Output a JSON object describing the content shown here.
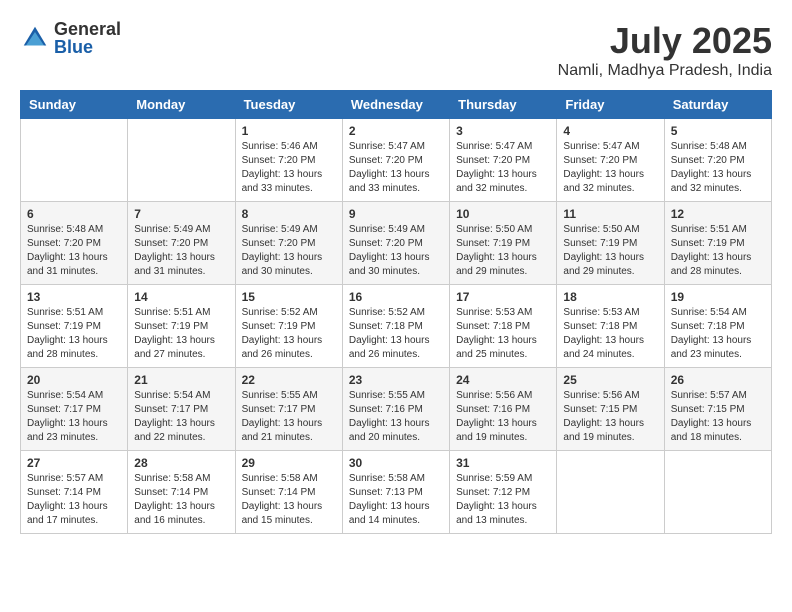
{
  "logo": {
    "general": "General",
    "blue": "Blue"
  },
  "title": {
    "month_year": "July 2025",
    "location": "Namli, Madhya Pradesh, India"
  },
  "headers": [
    "Sunday",
    "Monday",
    "Tuesday",
    "Wednesday",
    "Thursday",
    "Friday",
    "Saturday"
  ],
  "weeks": [
    [
      {
        "day": "",
        "info": ""
      },
      {
        "day": "",
        "info": ""
      },
      {
        "day": "1",
        "info": "Sunrise: 5:46 AM\nSunset: 7:20 PM\nDaylight: 13 hours\nand 33 minutes."
      },
      {
        "day": "2",
        "info": "Sunrise: 5:47 AM\nSunset: 7:20 PM\nDaylight: 13 hours\nand 33 minutes."
      },
      {
        "day": "3",
        "info": "Sunrise: 5:47 AM\nSunset: 7:20 PM\nDaylight: 13 hours\nand 32 minutes."
      },
      {
        "day": "4",
        "info": "Sunrise: 5:47 AM\nSunset: 7:20 PM\nDaylight: 13 hours\nand 32 minutes."
      },
      {
        "day": "5",
        "info": "Sunrise: 5:48 AM\nSunset: 7:20 PM\nDaylight: 13 hours\nand 32 minutes."
      }
    ],
    [
      {
        "day": "6",
        "info": "Sunrise: 5:48 AM\nSunset: 7:20 PM\nDaylight: 13 hours\nand 31 minutes."
      },
      {
        "day": "7",
        "info": "Sunrise: 5:49 AM\nSunset: 7:20 PM\nDaylight: 13 hours\nand 31 minutes."
      },
      {
        "day": "8",
        "info": "Sunrise: 5:49 AM\nSunset: 7:20 PM\nDaylight: 13 hours\nand 30 minutes."
      },
      {
        "day": "9",
        "info": "Sunrise: 5:49 AM\nSunset: 7:20 PM\nDaylight: 13 hours\nand 30 minutes."
      },
      {
        "day": "10",
        "info": "Sunrise: 5:50 AM\nSunset: 7:19 PM\nDaylight: 13 hours\nand 29 minutes."
      },
      {
        "day": "11",
        "info": "Sunrise: 5:50 AM\nSunset: 7:19 PM\nDaylight: 13 hours\nand 29 minutes."
      },
      {
        "day": "12",
        "info": "Sunrise: 5:51 AM\nSunset: 7:19 PM\nDaylight: 13 hours\nand 28 minutes."
      }
    ],
    [
      {
        "day": "13",
        "info": "Sunrise: 5:51 AM\nSunset: 7:19 PM\nDaylight: 13 hours\nand 28 minutes."
      },
      {
        "day": "14",
        "info": "Sunrise: 5:51 AM\nSunset: 7:19 PM\nDaylight: 13 hours\nand 27 minutes."
      },
      {
        "day": "15",
        "info": "Sunrise: 5:52 AM\nSunset: 7:19 PM\nDaylight: 13 hours\nand 26 minutes."
      },
      {
        "day": "16",
        "info": "Sunrise: 5:52 AM\nSunset: 7:18 PM\nDaylight: 13 hours\nand 26 minutes."
      },
      {
        "day": "17",
        "info": "Sunrise: 5:53 AM\nSunset: 7:18 PM\nDaylight: 13 hours\nand 25 minutes."
      },
      {
        "day": "18",
        "info": "Sunrise: 5:53 AM\nSunset: 7:18 PM\nDaylight: 13 hours\nand 24 minutes."
      },
      {
        "day": "19",
        "info": "Sunrise: 5:54 AM\nSunset: 7:18 PM\nDaylight: 13 hours\nand 23 minutes."
      }
    ],
    [
      {
        "day": "20",
        "info": "Sunrise: 5:54 AM\nSunset: 7:17 PM\nDaylight: 13 hours\nand 23 minutes."
      },
      {
        "day": "21",
        "info": "Sunrise: 5:54 AM\nSunset: 7:17 PM\nDaylight: 13 hours\nand 22 minutes."
      },
      {
        "day": "22",
        "info": "Sunrise: 5:55 AM\nSunset: 7:17 PM\nDaylight: 13 hours\nand 21 minutes."
      },
      {
        "day": "23",
        "info": "Sunrise: 5:55 AM\nSunset: 7:16 PM\nDaylight: 13 hours\nand 20 minutes."
      },
      {
        "day": "24",
        "info": "Sunrise: 5:56 AM\nSunset: 7:16 PM\nDaylight: 13 hours\nand 19 minutes."
      },
      {
        "day": "25",
        "info": "Sunrise: 5:56 AM\nSunset: 7:15 PM\nDaylight: 13 hours\nand 19 minutes."
      },
      {
        "day": "26",
        "info": "Sunrise: 5:57 AM\nSunset: 7:15 PM\nDaylight: 13 hours\nand 18 minutes."
      }
    ],
    [
      {
        "day": "27",
        "info": "Sunrise: 5:57 AM\nSunset: 7:14 PM\nDaylight: 13 hours\nand 17 minutes."
      },
      {
        "day": "28",
        "info": "Sunrise: 5:58 AM\nSunset: 7:14 PM\nDaylight: 13 hours\nand 16 minutes."
      },
      {
        "day": "29",
        "info": "Sunrise: 5:58 AM\nSunset: 7:14 PM\nDaylight: 13 hours\nand 15 minutes."
      },
      {
        "day": "30",
        "info": "Sunrise: 5:58 AM\nSunset: 7:13 PM\nDaylight: 13 hours\nand 14 minutes."
      },
      {
        "day": "31",
        "info": "Sunrise: 5:59 AM\nSunset: 7:12 PM\nDaylight: 13 hours\nand 13 minutes."
      },
      {
        "day": "",
        "info": ""
      },
      {
        "day": "",
        "info": ""
      }
    ]
  ]
}
